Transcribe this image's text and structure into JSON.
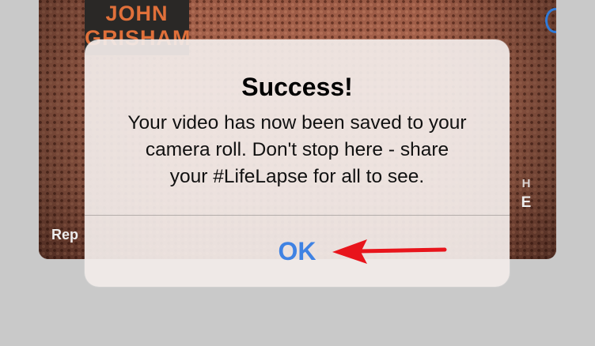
{
  "background": {
    "book_author": "JOHN\nGRISHAM",
    "side_letters": [
      "H",
      "E"
    ],
    "repeat_label": "Rep"
  },
  "alert": {
    "title": "Success!",
    "message": "Your video has now been saved to your\ncamera roll. Don't stop here - share\nyour #LifeLapse for all to see.",
    "ok_label": "OK"
  },
  "colors": {
    "ok_text": "#3f82e3",
    "annotation_arrow": "#e8141b",
    "alert_background": "#f2ecea"
  },
  "icons": {
    "annotation": "red-arrow-left-icon"
  }
}
